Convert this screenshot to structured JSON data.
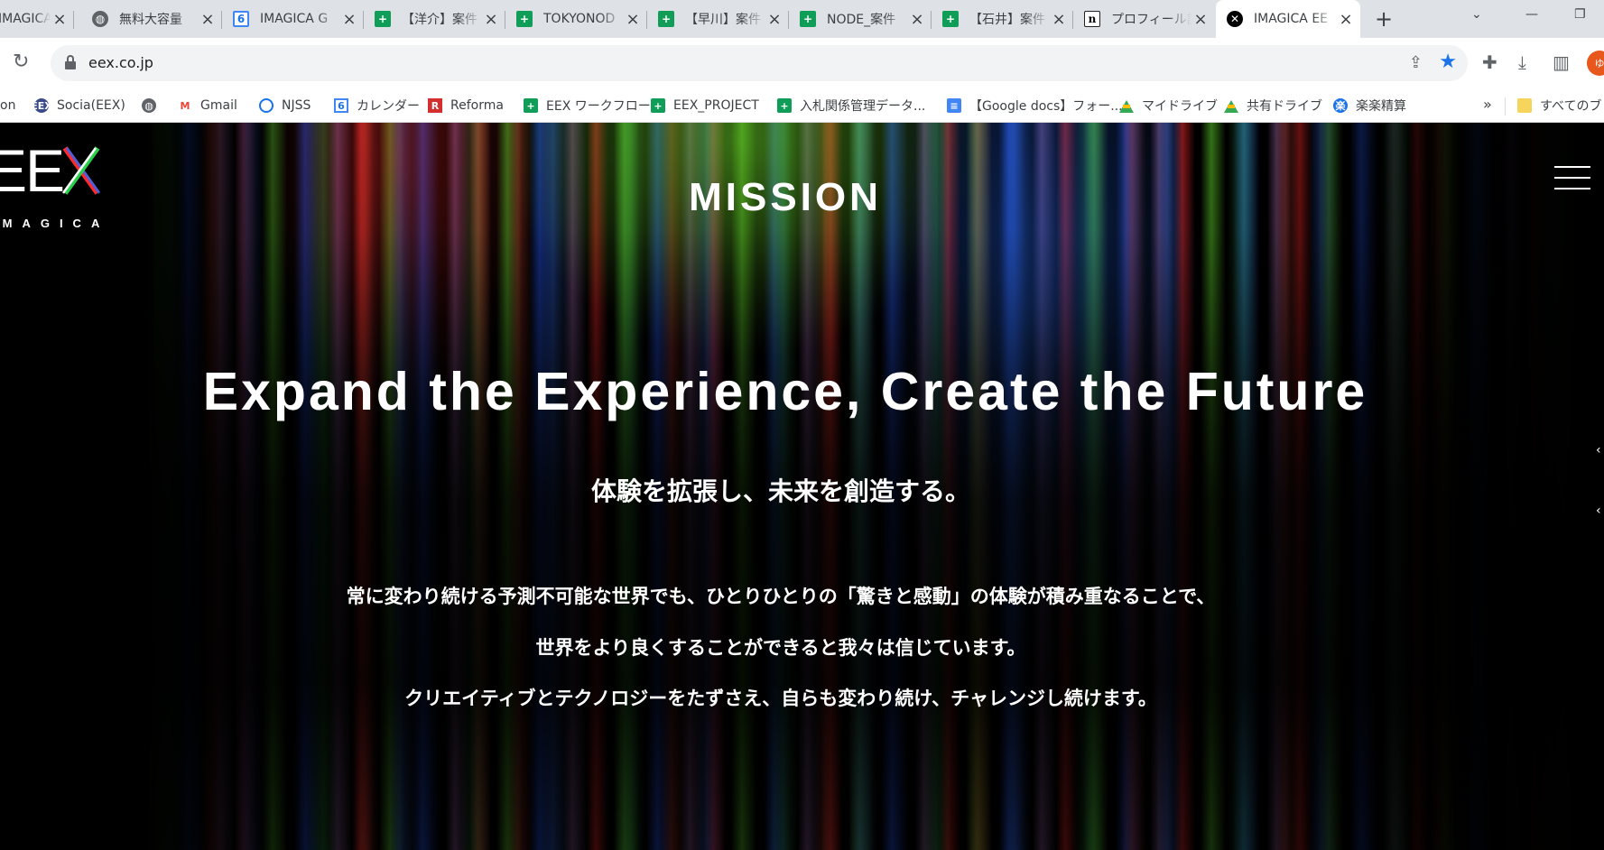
{
  "browser": {
    "tabs": [
      {
        "title": "IMAGICA GE",
        "icon": "imagica-icon",
        "active": false
      },
      {
        "title": "無料大容量",
        "icon": "globe-icon",
        "active": false
      },
      {
        "title": "IMAGICA G",
        "icon": "google-calendar-icon",
        "active": false
      },
      {
        "title": "【洋介】案件",
        "icon": "google-sheets-icon",
        "active": false
      },
      {
        "title": "TOKYONOD",
        "icon": "google-sheets-icon",
        "active": false
      },
      {
        "title": "【早川】案件",
        "icon": "google-sheets-icon",
        "active": false
      },
      {
        "title": "NODE_案件",
        "icon": "google-sheets-icon",
        "active": false
      },
      {
        "title": "【石井】案件",
        "icon": "google-sheets-icon",
        "active": false
      },
      {
        "title": "プロフィール設",
        "icon": "notion-icon",
        "active": false
      },
      {
        "title": "IMAGICA EE",
        "icon": "eex-x-icon",
        "active": true
      }
    ],
    "new_tab_label": "+",
    "url": "eex.co.jp",
    "profile_initial": "ゆ",
    "bookmarks": [
      {
        "label": "on",
        "icon": "notion-icon"
      },
      {
        "label": "Socia(EEX)",
        "icon": "socia-icon"
      },
      {
        "label": "",
        "icon": "globe-icon"
      },
      {
        "label": "Gmail",
        "icon": "gmail-icon"
      },
      {
        "label": "NJSS",
        "icon": "njss-icon"
      },
      {
        "label": "カレンダー",
        "icon": "google-calendar-icon"
      },
      {
        "label": "Reforma",
        "icon": "reforma-icon"
      },
      {
        "label": "EEX ワークフロー",
        "icon": "google-sheets-icon"
      },
      {
        "label": "EEX_PROJECT",
        "icon": "google-sheets-icon"
      },
      {
        "label": "入札関係管理データ...",
        "icon": "google-sheets-icon"
      },
      {
        "label": "【Google docs】フォー...",
        "icon": "google-docs-icon"
      },
      {
        "label": "マイドライブ",
        "icon": "google-drive-icon"
      },
      {
        "label": "共有ドライブ",
        "icon": "google-drive-icon"
      },
      {
        "label": "楽楽精算",
        "icon": "rakuraku-icon"
      }
    ],
    "bookmarks_more": "»",
    "all_bookmarks_label": "すべてのブッ"
  },
  "site": {
    "logo_text": "EEX",
    "logo_subtext": "IMAGICA",
    "section_title": "MISSION",
    "headline": "Expand the Experience, Create the Future",
    "subheadline": "体験を拡張し、未来を創造する。",
    "paragraphs": [
      "常に変わり続ける予測不可能な世界でも、ひとりひとりの「驚きと感動」の体験が積み重なることで、",
      "世界をより良くすることができると我々は信じています。",
      "クリエイティブとテクノロジーをたずさえ、自らも変わり続け、チャレンジし続けます。"
    ]
  },
  "colors": {
    "accent_blue": "#1a73e8",
    "sheets_green": "#0f9d58",
    "page_background": "#000000",
    "page_text": "#ffffff"
  }
}
